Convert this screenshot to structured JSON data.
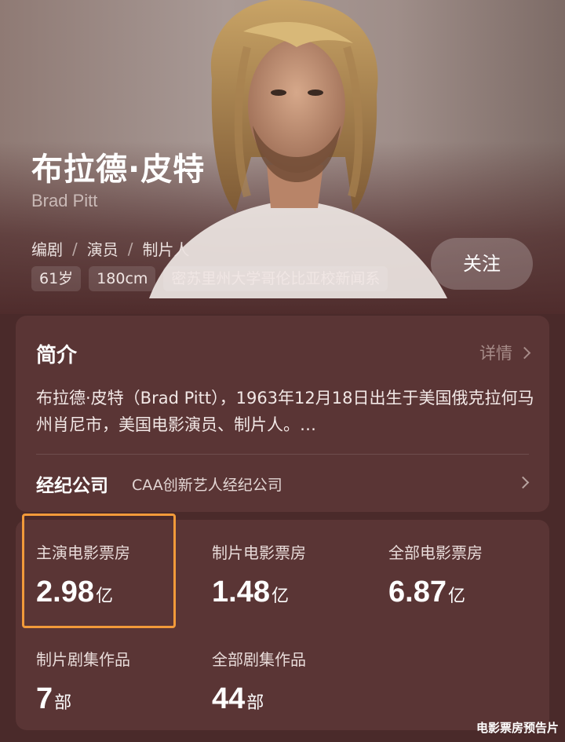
{
  "profile": {
    "name_cn": "布拉德·皮特",
    "name_en": "Brad Pitt",
    "roles": [
      "编剧",
      "演员",
      "制片人"
    ],
    "tags": [
      "61岁",
      "180cm",
      "密苏里州大学哥伦比亚校新闻系"
    ],
    "follow_label": "关注"
  },
  "intro": {
    "title": "简介",
    "detail_label": "详情",
    "bio": "布拉德·皮特（Brad Pitt），1963年12月18日出生于美国俄克拉何马州肖尼市，美国电影演员、制片人。…",
    "agency_label": "经纪公司",
    "agency_value": "CAA创新艺人经纪公司"
  },
  "stats": [
    {
      "label": "主演电影票房",
      "value": "2.98",
      "unit": "亿",
      "highlighted": true
    },
    {
      "label": "制片电影票房",
      "value": "1.48",
      "unit": "亿"
    },
    {
      "label": "全部电影票房",
      "value": "6.87",
      "unit": "亿"
    },
    {
      "label": "制片剧集作品",
      "value": "7",
      "unit": "部"
    },
    {
      "label": "全部剧集作品",
      "value": "44",
      "unit": "部"
    }
  ],
  "watermark": "电影票房预告片",
  "colors": {
    "background": "#4a2a2a",
    "card": "#5a3535",
    "highlight": "#f29a3a",
    "muted_link": "#a68b88"
  }
}
